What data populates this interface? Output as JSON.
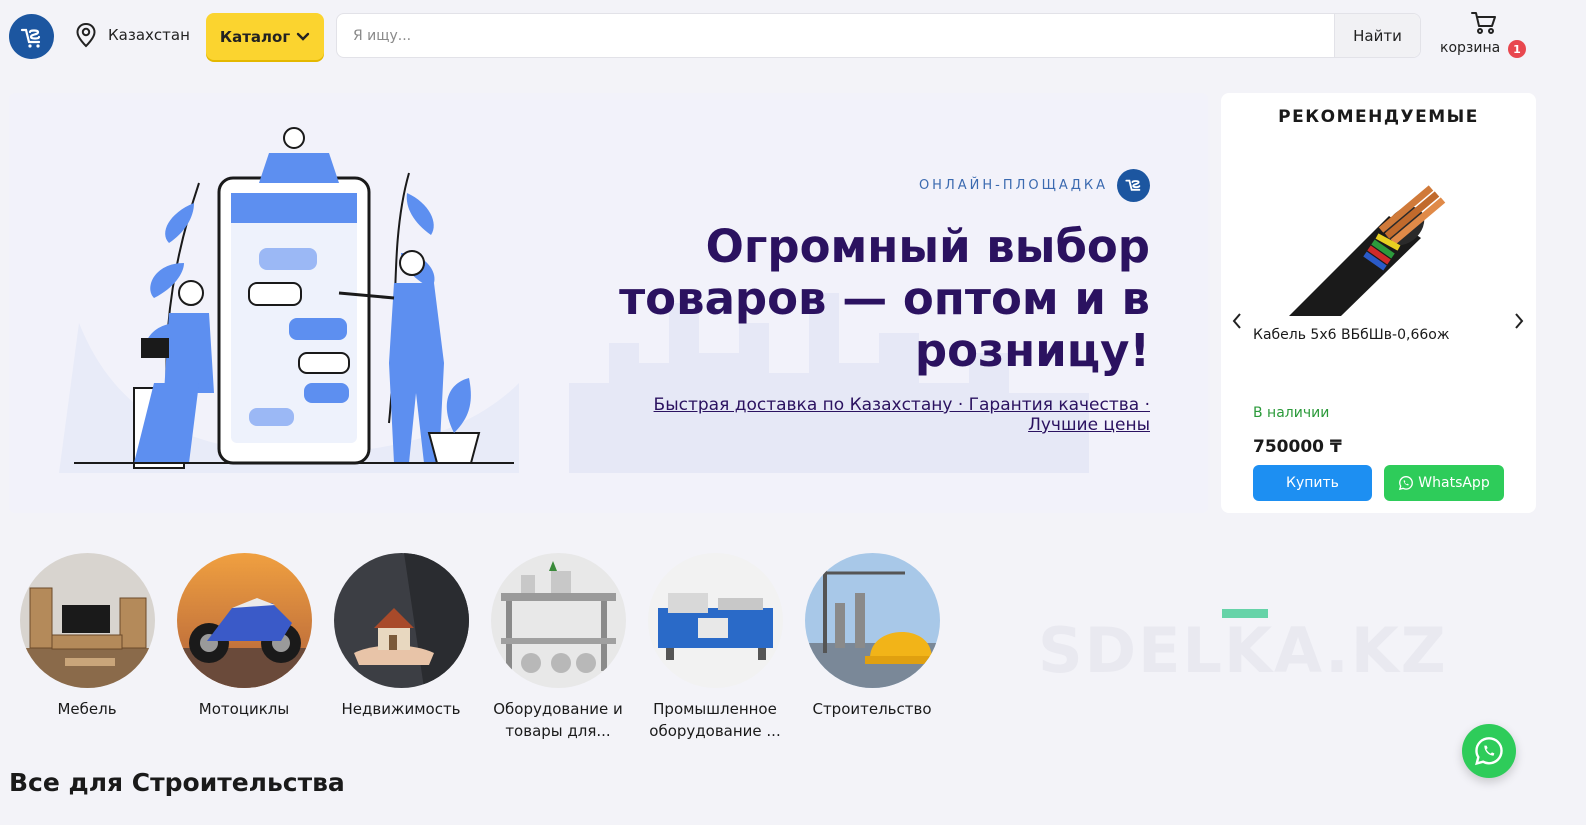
{
  "header": {
    "location": "Казахстан",
    "catalog_label": "Каталог",
    "search_placeholder": "Я ищу...",
    "search_button": "Найти",
    "cart_label": "корзина",
    "cart_count": "1"
  },
  "hero": {
    "tag": "ОНЛАЙН-ПЛОЩАДКА",
    "title": "Огромный выбор товаров — оптом и в розницу!",
    "subtitle": "Быстрая доставка по Казахстану · Гарантия качества · Лучшие цены"
  },
  "recommended": {
    "title": "РЕКОМЕНДУЕМЫЕ",
    "product_name": "Кабель 5х6 ВБбШв-0,66ож",
    "stock": "В наличии",
    "price": "750000 ₸",
    "buy_label": "Купить",
    "whatsapp_label": "WhatsApp"
  },
  "categories": [
    {
      "label": "Мебель"
    },
    {
      "label": "Мотоциклы"
    },
    {
      "label": "Недвижимость"
    },
    {
      "label": "Оборудование и товары для..."
    },
    {
      "label": "Промышленное оборудование ..."
    },
    {
      "label": "Строительство"
    }
  ],
  "watermark": "SDELKA.KZ",
  "section_title": "Все для Строительства",
  "colors": {
    "brand_blue": "#1c56a0",
    "catalog_yellow": "#fbd42f",
    "hero_text": "#2b1260",
    "buy_blue": "#1d8ff2",
    "whatsapp_green": "#2ecc5a",
    "badge_red": "#e8474f"
  },
  "icons": [
    "logo-icon",
    "location-pin-icon",
    "chevron-down-icon",
    "cart-icon",
    "chevron-left-icon",
    "chevron-right-icon",
    "whatsapp-icon"
  ]
}
